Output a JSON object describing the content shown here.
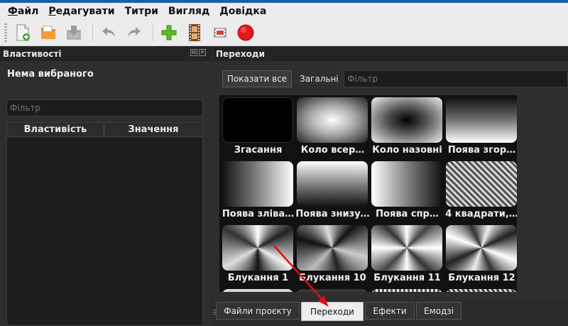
{
  "menu": {
    "items": [
      {
        "first": "Ф",
        "rest": "айл"
      },
      {
        "first": "Р",
        "rest": "едагувати"
      },
      {
        "first": "",
        "rest": "Титри"
      },
      {
        "first": "",
        "rest": "Вигляд"
      },
      {
        "first": "",
        "rest": "Довідка"
      }
    ]
  },
  "toolbar": {
    "buttons": [
      "new-file-icon",
      "open-folder-icon",
      "save-icon",
      "undo-icon",
      "redo-icon",
      "add-icon",
      "film-strip-icon",
      "preview-icon",
      "record-icon"
    ]
  },
  "properties": {
    "title": "Властивості",
    "nothing_selected": "Нема вибраного",
    "filter_placeholder": "Фільтр",
    "col_property": "Властивість",
    "col_value": "Значення"
  },
  "transitions": {
    "title": "Переходи",
    "show_all": "Показати все",
    "general": "Загальні",
    "filter_placeholder": "Фільтр",
    "items": [
      "Згасання",
      "Коло всер…",
      "Коло назовні",
      "Поява згор…",
      "Поява зліва…",
      "Поява знизу…",
      "Поява спр…",
      "4 квадрати,…",
      "Блукання 1",
      "Блукання 10",
      "Блукання 11",
      "Блукання 12"
    ]
  },
  "tabs": {
    "project_files": "Файли проєкту",
    "transitions": "Переходи",
    "effects": "Ефекти",
    "emoji": "Емодзі"
  },
  "colors": {
    "accent_blue": "#1b5ea8",
    "annotation_red": "#e01010",
    "record_red": "#e11b1b"
  }
}
